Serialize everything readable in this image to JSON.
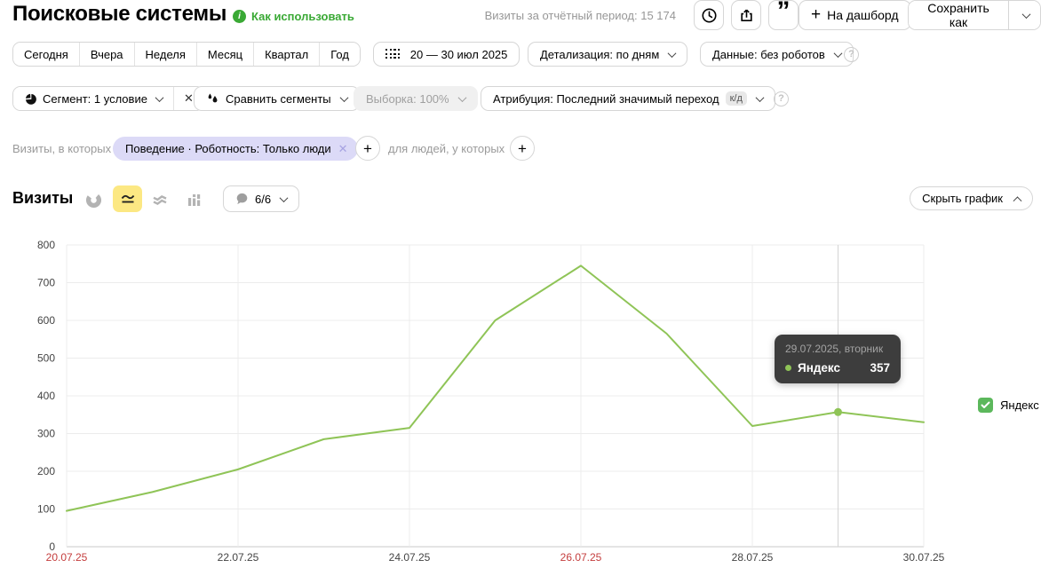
{
  "header": {
    "title": "Поисковые системы",
    "how_to_use": "Как использовать",
    "period_label": "Визиты за отчётный период: 15 174",
    "dashboard_button": "На дашборд",
    "dashboard_plus": "+",
    "save_as_button": "Сохранить как"
  },
  "toolbar": {
    "presets": [
      "Сегодня",
      "Вчера",
      "Неделя",
      "Месяц",
      "Квартал",
      "Год"
    ],
    "date_range": "20 — 30 июл 2025",
    "detail": "Детализация: по дням",
    "data_mode": "Данные: без роботов"
  },
  "segments": {
    "segment": "Сегмент: 1 условие",
    "close": "✕",
    "compare": "Сравнить сегменты",
    "sampling": "Выборка: 100%",
    "attribution": "Атрибуция: Последний значимый переход",
    "attribution_badge": "к/д"
  },
  "filters": {
    "visits_in_which": "Визиты, в которых",
    "chip": "Поведение · Роботность: Только люди",
    "chip_close": "✕",
    "plus": "+",
    "for_people": "для людей, у которых"
  },
  "chart_section": {
    "title": "Визиты",
    "metric_selector": "6/6",
    "hide_chart": "Скрыть график"
  },
  "tooltip": {
    "date": "29.07.2025, вторник",
    "series": "Яндекс",
    "value": "357"
  },
  "legend": {
    "label": "Яндекс"
  },
  "colors": {
    "line_green": "#8fc457",
    "legend_green": "#5cb85c",
    "accent_green": "#3aa935",
    "selected_yellow": "#fce883",
    "chip_lavender": "#dcdaf7",
    "weekend_red": "#c43d3d",
    "grid": "#ececec",
    "axis": "#c9c9c9",
    "crosshair": "#d4d4d4",
    "tick_text": "#444444"
  },
  "chart_data": {
    "type": "line",
    "title": "Визиты",
    "x": [
      "20.07.25",
      "21.07.25",
      "22.07.25",
      "23.07.25",
      "24.07.25",
      "25.07.25",
      "26.07.25",
      "27.07.25",
      "28.07.25",
      "29.07.25",
      "30.07.25"
    ],
    "series": [
      {
        "name": "Яндекс",
        "color": "#8fc457",
        "values": [
          95,
          145,
          205,
          285,
          315,
          600,
          745,
          565,
          320,
          357,
          330
        ]
      }
    ],
    "ylim": [
      0,
      800
    ],
    "y_ticks": [
      0,
      100,
      200,
      300,
      400,
      500,
      600,
      700,
      800
    ],
    "x_tick_labels": [
      {
        "day": 0,
        "text": "20.07.25",
        "red": true
      },
      {
        "day": 2,
        "text": "22.07.25",
        "red": false
      },
      {
        "day": 4,
        "text": "24.07.25",
        "red": false
      },
      {
        "day": 6,
        "text": "26.07.25",
        "red": true
      },
      {
        "day": 8,
        "text": "28.07.25",
        "red": false
      },
      {
        "day": 10,
        "text": "30.07.25",
        "red": false
      }
    ],
    "grid": true,
    "legend_position": "right",
    "hover_index": 9
  }
}
